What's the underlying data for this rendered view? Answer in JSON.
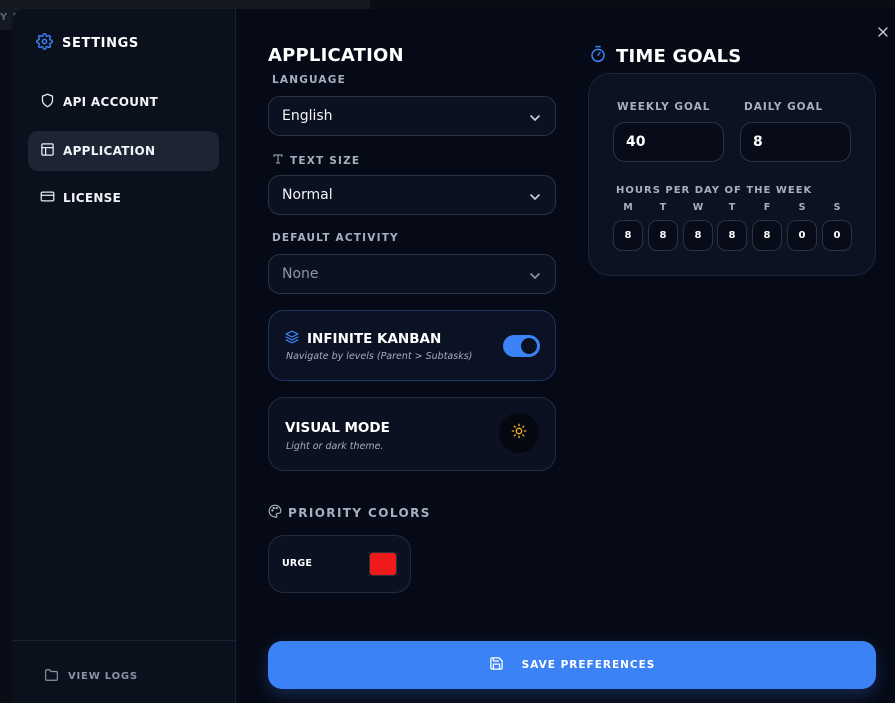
{
  "backdrop": {
    "peek_text": "Y L"
  },
  "sidebar": {
    "title": "SETTINGS",
    "items": [
      {
        "label": "API ACCOUNT",
        "icon": "shield-icon",
        "active": false
      },
      {
        "label": "APPLICATION",
        "icon": "layout-icon",
        "active": true
      },
      {
        "label": "LICENSE",
        "icon": "credit-card-icon",
        "active": false
      }
    ],
    "footer": {
      "label": "VIEW LOGS",
      "icon": "folder-icon"
    }
  },
  "application": {
    "title": "APPLICATION",
    "language": {
      "label": "LANGUAGE",
      "value": "English"
    },
    "text_size": {
      "label": "TEXT SIZE",
      "value": "Normal"
    },
    "default_activity": {
      "label": "DEFAULT ACTIVITY",
      "value": "None"
    },
    "infinite_kanban": {
      "title": "INFINITE KANBAN",
      "subtitle": "Navigate by levels (Parent > Subtasks)",
      "enabled": true
    },
    "visual_mode": {
      "title": "VISUAL MODE",
      "subtitle": "Light or dark theme.",
      "icon": "sun-icon"
    },
    "priority_colors": {
      "title": "PRIORITY COLORS",
      "items": [
        {
          "label": "URGE",
          "color": "#f01a1a"
        }
      ]
    }
  },
  "time_goals": {
    "title": "TIME GOALS",
    "weekly": {
      "label": "WEEKLY GOAL",
      "value": "40"
    },
    "daily": {
      "label": "DAILY GOAL",
      "value": "8"
    },
    "days_label": "HOURS PER DAY OF THE WEEK",
    "days": [
      {
        "letter": "M",
        "value": "8"
      },
      {
        "letter": "T",
        "value": "8"
      },
      {
        "letter": "W",
        "value": "8"
      },
      {
        "letter": "T",
        "value": "8"
      },
      {
        "letter": "F",
        "value": "8"
      },
      {
        "letter": "S",
        "value": "0"
      },
      {
        "letter": "S",
        "value": "0"
      }
    ]
  },
  "save_button": {
    "label": "SAVE PREFERENCES"
  },
  "colors": {
    "accent": "#3b82f6",
    "background": "#060a16",
    "sidebar": "#0b101d",
    "urgent": "#f01a1a"
  }
}
